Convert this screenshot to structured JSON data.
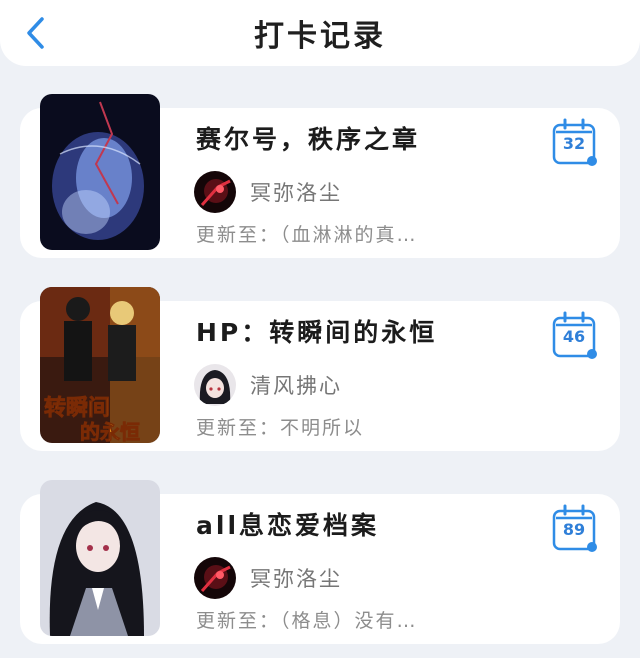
{
  "header": {
    "title": "打卡记录",
    "back_icon": "chevron-left-icon"
  },
  "colors": {
    "accent": "#2f8ce6",
    "background": "#eef1f6",
    "card": "#ffffff"
  },
  "entries": [
    {
      "title": "赛尔号，秩序之章",
      "author": "冥弥洛尘",
      "update": "更新至：（血淋淋的真…",
      "days": "32"
    },
    {
      "title": "HP：转瞬间的永恒",
      "author": "清风拂心",
      "update": "更新至：不明所以",
      "days": "46"
    },
    {
      "title": "all息恋爱档案",
      "author": "冥弥洛尘",
      "update": "更新至：（格息）没有…",
      "days": "89"
    }
  ]
}
